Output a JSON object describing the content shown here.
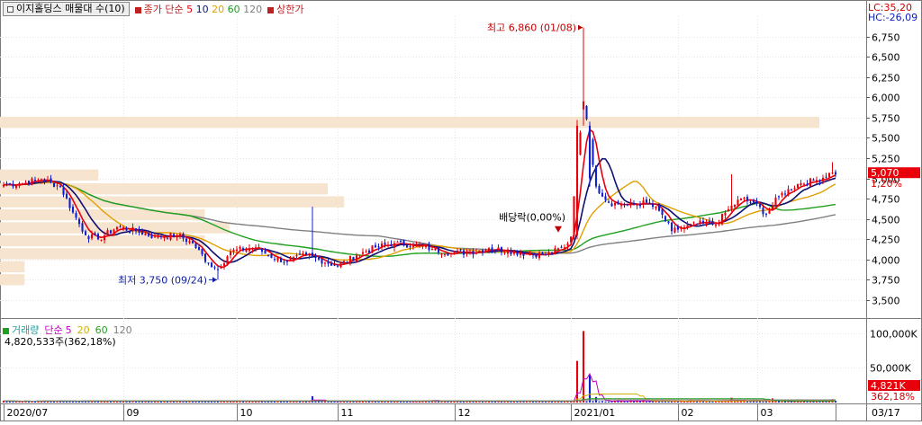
{
  "header": {
    "title": "이지홀딩스 매물대 수(10)",
    "ma_labels": [
      "종가 단순",
      "5",
      "10",
      "20",
      "60",
      "120"
    ],
    "limit_label": "상한가",
    "lc_label": "LC:35,20",
    "hc_label": "HC:-26,09"
  },
  "volume_header": {
    "title": "거래량",
    "ma_labels": [
      "단순",
      "5",
      "20",
      "60",
      "120"
    ],
    "current_volume": "4,820,533주(362,18%)"
  },
  "colors": {
    "up": "#e8000b",
    "down": "#1020d0",
    "ma5": "#e8000b",
    "ma10": "#101070",
    "ma20": "#e0a000",
    "ma60": "#20a020",
    "ma120": "#808080",
    "volume_profile": "#f7e4cf",
    "vol_ma5": "#c000c0",
    "vol_ma20": "#d0b000",
    "vol_ma60": "#20a020",
    "vol_ma120": "#808080"
  },
  "chart_data": {
    "type": "candlestick",
    "price_axis": {
      "ylim": [
        3300,
        7000
      ],
      "ticks": [
        "6,750",
        "6,500",
        "6,250",
        "6,000",
        "5,750",
        "5,500",
        "5,250",
        "5,000",
        "4,750",
        "4,500",
        "4,250",
        "4,000",
        "3,750",
        "3,500"
      ],
      "tick_values": [
        6750,
        6500,
        6250,
        6000,
        5750,
        5500,
        5250,
        5000,
        4750,
        4500,
        4250,
        4000,
        3750,
        3500
      ]
    },
    "volume_axis": {
      "ylim": [
        0,
        110000
      ],
      "ticks": [
        "100,000K",
        "50,000K"
      ],
      "tick_values": [
        100000,
        50000
      ]
    },
    "x_axis_labels": [
      {
        "label": "2020/07",
        "index": 0
      },
      {
        "label": "09",
        "index": 38
      },
      {
        "label": "10",
        "index": 74
      },
      {
        "label": "11",
        "index": 106
      },
      {
        "label": "12",
        "index": 143
      },
      {
        "label": "2021/01",
        "index": 180
      },
      {
        "label": "02",
        "index": 214
      },
      {
        "label": "03",
        "index": 239
      },
      {
        "label": "03/17",
        "index": 264
      }
    ],
    "date_range": {
      "first": "2020/07",
      "last": "03/17"
    },
    "last_close": "5,070",
    "last_change": "1,20%",
    "last_volume": "4,821K",
    "last_volume_ratio": "362,18%",
    "annotations": [
      {
        "text": "최고 6,860 (01/08)",
        "index": 184,
        "value": 6860,
        "type": "high"
      },
      {
        "text": "최저 3,750 (09/24)",
        "index": 68,
        "value": 3750,
        "type": "low"
      },
      {
        "text": "배당락(0,00%)",
        "index": 176,
        "value": 4300,
        "type": "event"
      }
    ],
    "volume_profile": [
      {
        "low": 5600,
        "high": 5760,
        "volume": 100
      },
      {
        "low": 4950,
        "high": 5110,
        "volume": 12
      },
      {
        "low": 4780,
        "high": 4940,
        "volume": 40
      },
      {
        "low": 4620,
        "high": 4780,
        "volume": 42
      },
      {
        "low": 4460,
        "high": 4620,
        "volume": 25
      },
      {
        "low": 4300,
        "high": 4460,
        "volume": 28
      },
      {
        "low": 4140,
        "high": 4300,
        "volume": 25
      },
      {
        "low": 3980,
        "high": 4140,
        "volume": 25
      },
      {
        "low": 3820,
        "high": 3980,
        "volume": 3
      },
      {
        "low": 3660,
        "high": 3820,
        "volume": 3
      }
    ],
    "key_points": [
      {
        "i": 0,
        "c": 4920
      },
      {
        "i": 5,
        "c": 4940
      },
      {
        "i": 12,
        "c": 4990
      },
      {
        "i": 18,
        "c": 4900
      },
      {
        "i": 22,
        "c": 4580
      },
      {
        "i": 26,
        "c": 4300
      },
      {
        "i": 30,
        "c": 4250
      },
      {
        "i": 36,
        "c": 4400
      },
      {
        "i": 42,
        "c": 4350
      },
      {
        "i": 48,
        "c": 4280
      },
      {
        "i": 55,
        "c": 4300
      },
      {
        "i": 60,
        "c": 4200
      },
      {
        "i": 65,
        "c": 3950
      },
      {
        "i": 68,
        "c": 3880
      },
      {
        "i": 72,
        "c": 4100
      },
      {
        "i": 80,
        "c": 4150
      },
      {
        "i": 84,
        "c": 4050
      },
      {
        "i": 90,
        "c": 3970
      },
      {
        "i": 96,
        "c": 4060
      },
      {
        "i": 100,
        "c": 4000
      },
      {
        "i": 106,
        "c": 3920
      },
      {
        "i": 112,
        "c": 4050
      },
      {
        "i": 118,
        "c": 4150
      },
      {
        "i": 124,
        "c": 4200
      },
      {
        "i": 130,
        "c": 4180
      },
      {
        "i": 136,
        "c": 4130
      },
      {
        "i": 142,
        "c": 4080
      },
      {
        "i": 148,
        "c": 4090
      },
      {
        "i": 154,
        "c": 4140
      },
      {
        "i": 160,
        "c": 4110
      },
      {
        "i": 166,
        "c": 4070
      },
      {
        "i": 172,
        "c": 4060
      },
      {
        "i": 178,
        "c": 4150
      },
      {
        "i": 180,
        "c": 4280
      },
      {
        "i": 182,
        "c": 5300
      },
      {
        "i": 184,
        "c": 5900
      },
      {
        "i": 186,
        "c": 5500
      },
      {
        "i": 188,
        "c": 4900
      },
      {
        "i": 192,
        "c": 4700
      },
      {
        "i": 198,
        "c": 4670
      },
      {
        "i": 204,
        "c": 4700
      },
      {
        "i": 208,
        "c": 4600
      },
      {
        "i": 212,
        "c": 4350
      },
      {
        "i": 216,
        "c": 4400
      },
      {
        "i": 222,
        "c": 4450
      },
      {
        "i": 226,
        "c": 4430
      },
      {
        "i": 230,
        "c": 4620
      },
      {
        "i": 234,
        "c": 4750
      },
      {
        "i": 238,
        "c": 4700
      },
      {
        "i": 242,
        "c": 4560
      },
      {
        "i": 246,
        "c": 4780
      },
      {
        "i": 252,
        "c": 4930
      },
      {
        "i": 258,
        "c": 4980
      },
      {
        "i": 263,
        "c": 5070
      }
    ],
    "volume_spikes": [
      {
        "i": 98,
        "v": 9000
      },
      {
        "i": 182,
        "v": 60000
      },
      {
        "i": 184,
        "v": 103000
      },
      {
        "i": 186,
        "v": 40000
      },
      {
        "i": 188,
        "v": 8000
      },
      {
        "i": 231,
        "v": 7000
      },
      {
        "i": 244,
        "v": 6000
      },
      {
        "i": 252,
        "v": 3000
      },
      {
        "i": 263,
        "v": 4821
      }
    ]
  }
}
